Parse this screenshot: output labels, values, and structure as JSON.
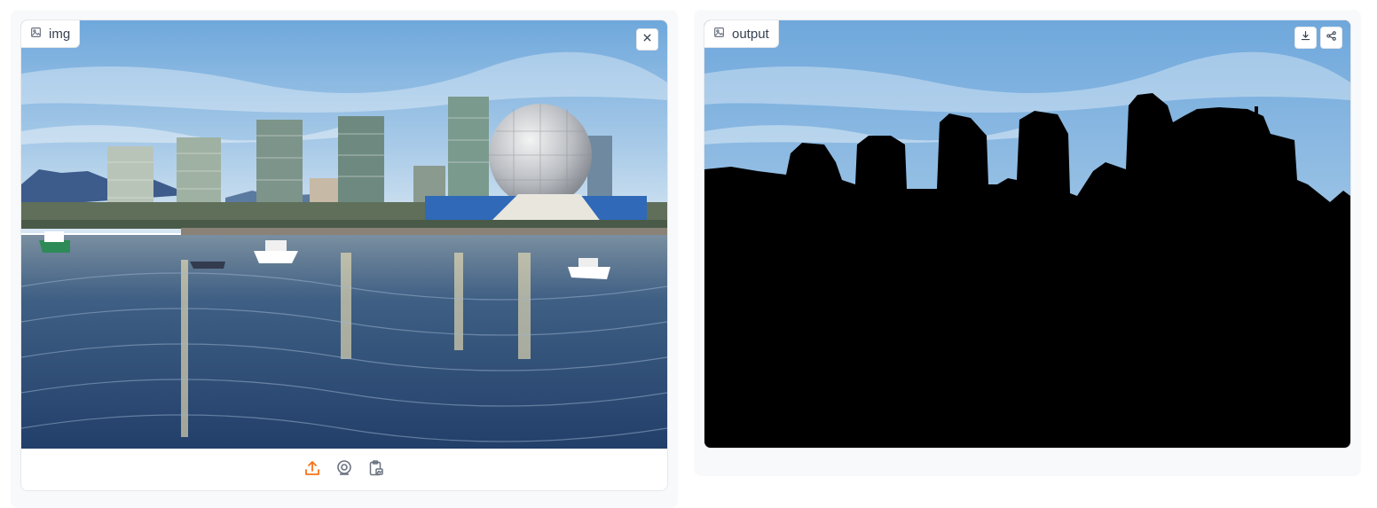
{
  "input_panel": {
    "label": "img",
    "label_icon": "image-icon",
    "clear_icon": "close-icon",
    "toolbar": [
      {
        "name": "upload-button",
        "icon": "upload-icon"
      },
      {
        "name": "webcam-button",
        "icon": "webcam-icon"
      },
      {
        "name": "clipboard-button",
        "icon": "clipboard-icon"
      }
    ],
    "accent_color": "#f97316"
  },
  "output_panel": {
    "label": "output",
    "label_icon": "image-icon",
    "actions": [
      {
        "name": "download-button",
        "icon": "download-icon"
      },
      {
        "name": "share-button",
        "icon": "share-icon"
      }
    ],
    "mask_color": "#000000"
  }
}
